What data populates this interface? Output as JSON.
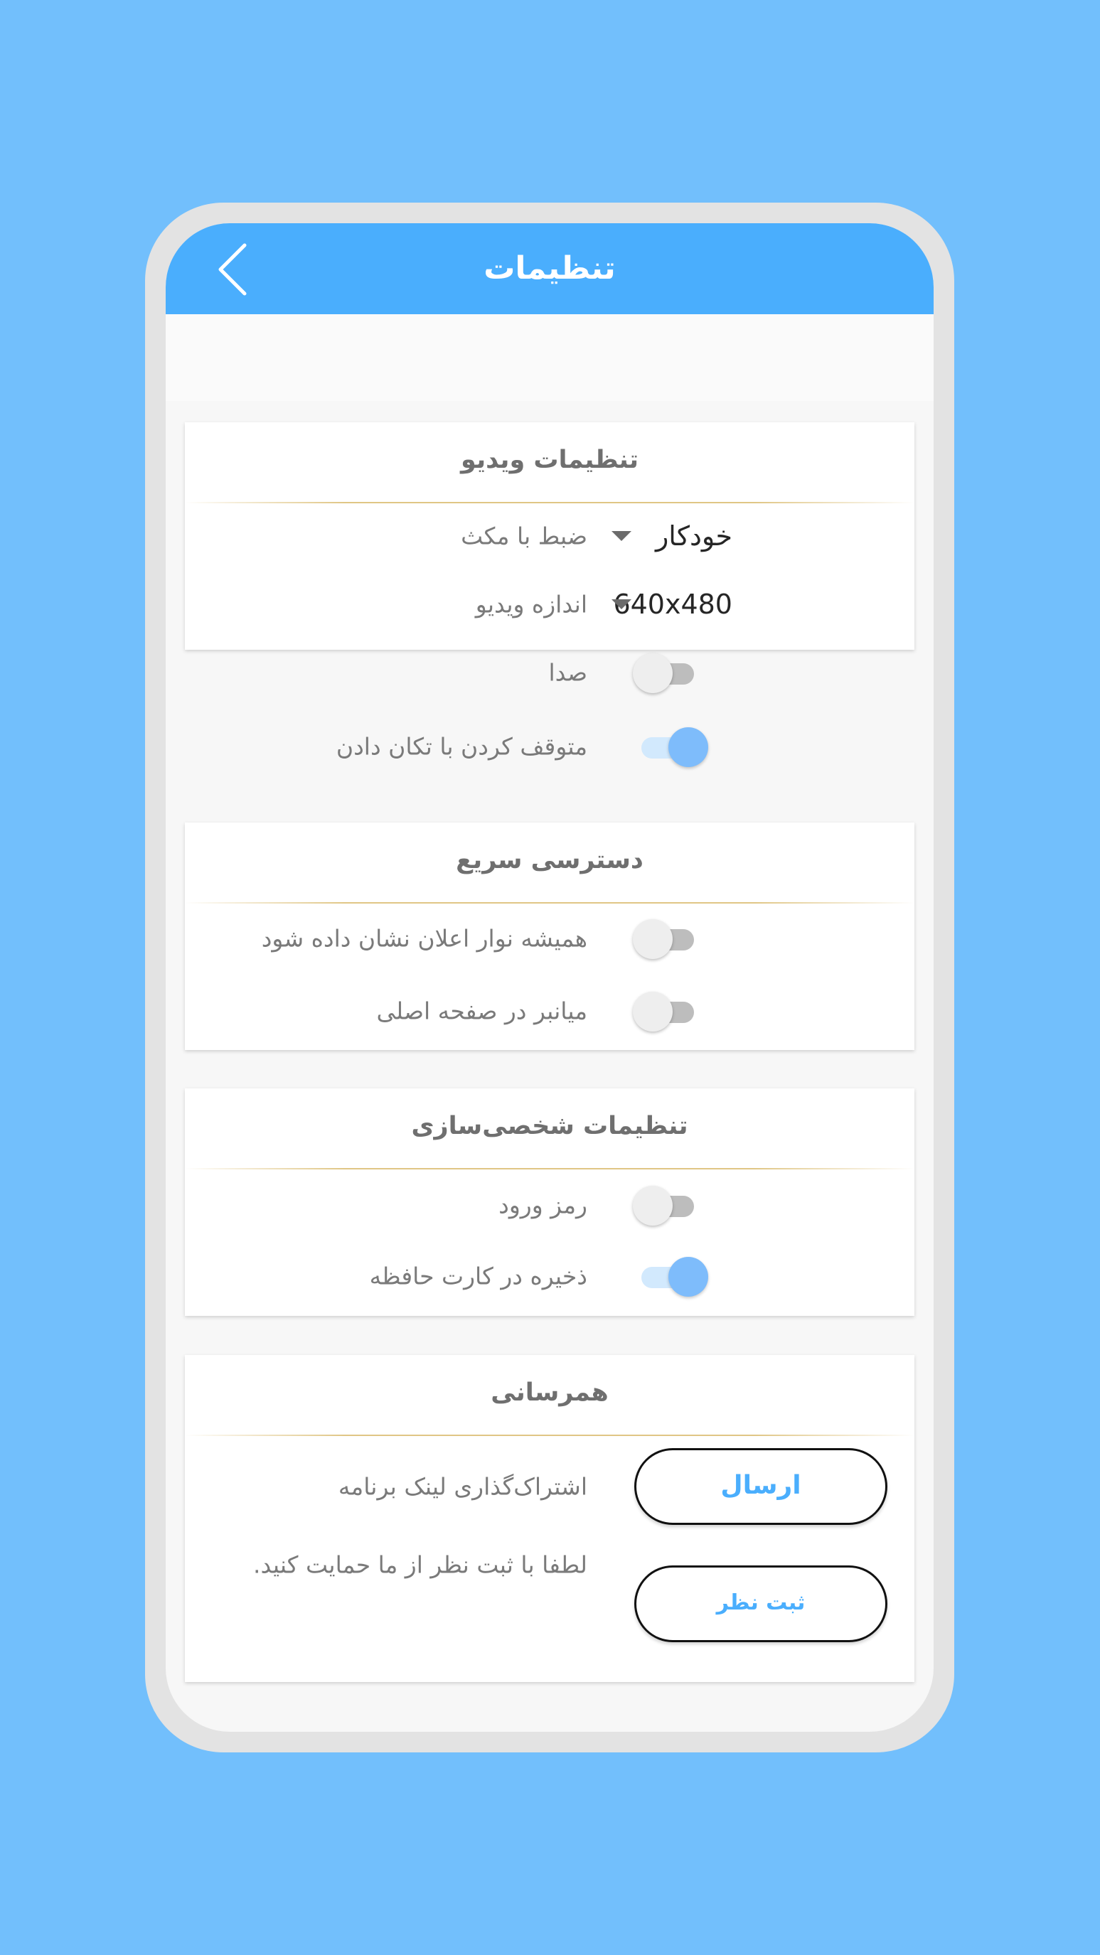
{
  "header": {
    "title": "تنظیمات"
  },
  "video_settings": {
    "title": "تنظیمات ویدیو",
    "record_mode": {
      "label": "ضبط با مکث",
      "value": "خودکار"
    },
    "video_size": {
      "label": "اندازه ویدیو",
      "value": "640x480"
    },
    "sound": {
      "label": "صدا",
      "on": false
    },
    "shake_stop": {
      "label": "متوقف کردن با تکان دادن",
      "on": true
    }
  },
  "quick_access": {
    "title": "دسترسی سریع",
    "notification_bar": {
      "label": "همیشه نوار اعلان نشان داده شود",
      "on": false
    },
    "home_shortcut": {
      "label": "میانبر در صفحه اصلی",
      "on": false
    }
  },
  "personalization": {
    "title": "تنظیمات شخصی‌سازی",
    "password": {
      "label": "رمز ورود",
      "on": false
    },
    "save_to_sd": {
      "label": "ذخیره در کارت حافظه",
      "on": true
    }
  },
  "sync": {
    "title": "همرسانی",
    "share": {
      "label": "اشتراک‌گذاری لینک برنامه",
      "button": "ارسال"
    },
    "rate": {
      "label": "لطفا با ثبت نظر از ما حمایت کنید.",
      "button": "ثبت نظر"
    }
  },
  "colors": {
    "background": "#72bffc",
    "accent": "#4aaefd",
    "toggle_on": "#7ebcfb",
    "toggle_off": "#bdbdbd",
    "divider": "#e0c685"
  }
}
